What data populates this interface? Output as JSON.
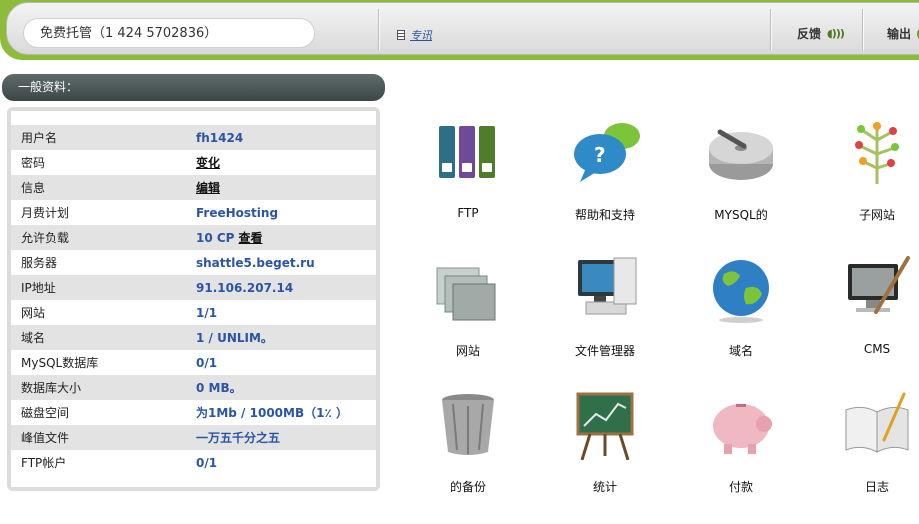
{
  "topbar": {
    "free_hosting": "免费托管（1 424 5702836）",
    "news_label": "专讯",
    "feedback_label": "反馈",
    "logout_label": "输出"
  },
  "panel": {
    "title": "一般资料：",
    "rows": [
      {
        "label": "用户名",
        "value": "fh1424"
      },
      {
        "label": "密码",
        "value": "变化"
      },
      {
        "label": "信息",
        "value": "编辑"
      },
      {
        "label": "月费计划",
        "value": "FreeHosting"
      },
      {
        "label": "允许负载",
        "value": "10 CP",
        "link": "查看"
      },
      {
        "label": "服务器",
        "value": "shattle5.beget.ru"
      },
      {
        "label": "IP地址",
        "value": "91.106.207.14"
      },
      {
        "label": "网站",
        "value": "1/1"
      },
      {
        "label": "域名",
        "value": "1 / UNLIM。"
      },
      {
        "label": "MySQL数据库",
        "value": "0/1"
      },
      {
        "label": "数据库大小",
        "value": "0 MB。"
      },
      {
        "label": "磁盘空间",
        "value": "为1Mb / 1000MB（1٪ ）"
      },
      {
        "label": "峰值文件",
        "value": "一万五千分之五"
      },
      {
        "label": "FTP帐户",
        "value": "0/1"
      }
    ]
  },
  "tiles": [
    {
      "label": "FTP",
      "icon": "ftp-binders-icon"
    },
    {
      "label": "帮助和支持",
      "icon": "help-bubbles-icon"
    },
    {
      "label": "MYSQL的",
      "icon": "mysql-disk-icon"
    },
    {
      "label": "子网站",
      "icon": "subsite-tree-icon"
    },
    {
      "label": "网站",
      "icon": "website-folders-icon"
    },
    {
      "label": "文件管理器",
      "icon": "file-manager-computer-icon"
    },
    {
      "label": "域名",
      "icon": "domain-globe-icon"
    },
    {
      "label": "CMS",
      "icon": "cms-monitor-brush-icon"
    },
    {
      "label": "的备份",
      "icon": "backup-trash-icon"
    },
    {
      "label": "统计",
      "icon": "stats-easel-icon"
    },
    {
      "label": "付款",
      "icon": "payment-piggy-icon"
    },
    {
      "label": "日志",
      "icon": "log-book-icon"
    }
  ]
}
